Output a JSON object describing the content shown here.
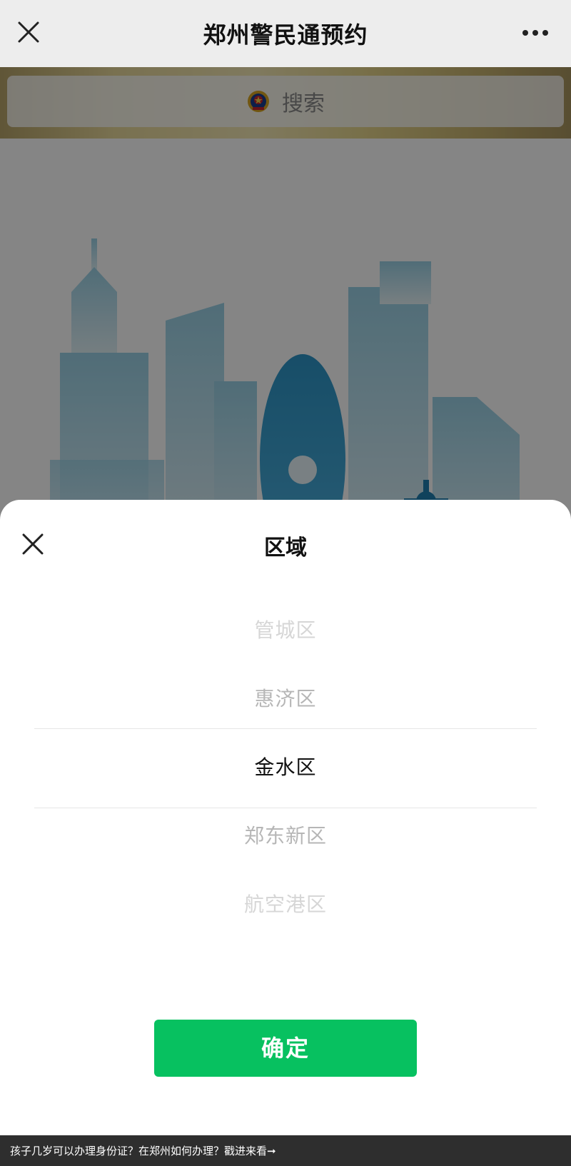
{
  "navbar": {
    "title": "郑州警民通预约",
    "close_icon": "close-icon",
    "more_icon": "more-dots-icon"
  },
  "page": {
    "search": {
      "emblem_icon": "police-emblem-icon",
      "placeholder": "搜索"
    },
    "illustration": "city-skyline-rocket-illustration"
  },
  "sheet": {
    "title": "区域",
    "close_icon": "close-icon",
    "options": [
      "管城区",
      "惠济区",
      "金水区",
      "郑东新区",
      "航空港区"
    ],
    "selected": "金水区",
    "confirm_label": "确定"
  },
  "caption": {
    "text": "孩子几岁可以办理身份证？在郑州如何办理？戳进来看➞"
  },
  "colors": {
    "accent_green": "#07c160",
    "overlay": "rgba(0,0,0,0.48)",
    "illustration_blue": "#1f7fb0"
  }
}
